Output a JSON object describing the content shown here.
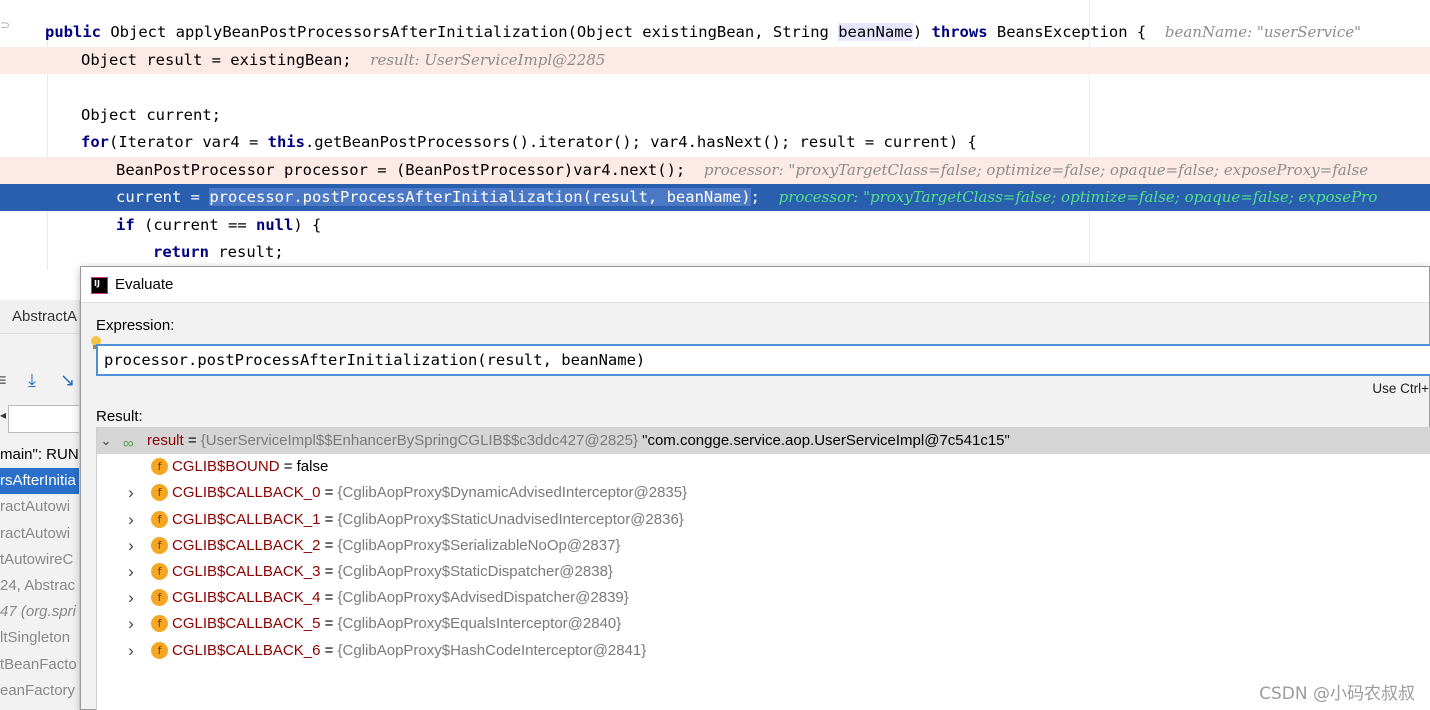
{
  "editor": {
    "lines": {
      "l1_kw_public": "public",
      "l1_a": " Object applyBeanPostProcessorsAfterInitialization(Object existingBean, String ",
      "l1_beanName": "beanName",
      "l1_b": ") ",
      "l1_kw_throws": "throws",
      "l1_c": " BeansException {",
      "l1_hint": "beanName: \"userService\"",
      "l2": "Object result = existingBean;",
      "l2_hint": "result: UserServiceImpl@2285",
      "l4": "Object current;",
      "l5_kw_for": "for",
      "l5_a": "(Iterator var4 = ",
      "l5_kw_this": "this",
      "l5_b": ".getBeanPostProcessors().iterator(); var4.hasNext(); result = current) {",
      "l6": "BeanPostProcessor processor = (BeanPostProcessor)var4.next();",
      "l6_hint": "processor: \"proxyTargetClass=false; optimize=false; opaque=false; exposeProxy=false",
      "l7_a": "current = ",
      "l7_sel": "processor.postProcessAfterInitialization(result, beanName)",
      "l7_b": ";",
      "l7_hint": "processor: \"proxyTargetClass=false; optimize=false; opaque=false; exposePro",
      "l8_kw_if": "if",
      "l8_a": " (current == ",
      "l8_kw_null": "null",
      "l8_b": ") {",
      "l9_kw_return": "return",
      "l9_a": " result;"
    }
  },
  "left_panel": {
    "tab": "AbstractA",
    "frames": [
      {
        "text": "main\": RUN",
        "style": "thread"
      },
      {
        "text": "rsAfterInitia",
        "style": "sel"
      },
      {
        "text": "ractAutowi",
        "style": "normal"
      },
      {
        "text": "ractAutowi",
        "style": "normal"
      },
      {
        "text": "tAutowireC",
        "style": "normal"
      },
      {
        "text": "24, Abstrac",
        "style": "normal"
      },
      {
        "text": "47 (org.spri",
        "style": "it"
      },
      {
        "text": "ltSingleton",
        "style": "normal"
      },
      {
        "text": "tBeanFacto",
        "style": "normal"
      },
      {
        "text": "eanFactory",
        "style": "normal"
      }
    ]
  },
  "dialog": {
    "title": "Evaluate",
    "expression_label": "Expression:",
    "expression_value": "processor.postProcessAfterInitialization(result, beanName)",
    "ctrl_hint": "Use Ctrl+",
    "result_label": "Result:",
    "result": {
      "name": "result",
      "eq": " = ",
      "type": "{UserServiceImpl$$EnhancerBySpringCGLIB$$c3ddc427@2825}",
      "value": " \"com.congge.service.aop.UserServiceImpl@7c541c15\""
    },
    "fields": [
      {
        "name": "CGLIB$BOUND",
        "type": "",
        "value": "false",
        "expandable": false
      },
      {
        "name": "CGLIB$CALLBACK_0",
        "type": "{CglibAopProxy$DynamicAdvisedInterceptor@2835}",
        "value": "",
        "expandable": true
      },
      {
        "name": "CGLIB$CALLBACK_1",
        "type": "{CglibAopProxy$StaticUnadvisedInterceptor@2836}",
        "value": "",
        "expandable": true
      },
      {
        "name": "CGLIB$CALLBACK_2",
        "type": "{CglibAopProxy$SerializableNoOp@2837}",
        "value": "",
        "expandable": true
      },
      {
        "name": "CGLIB$CALLBACK_3",
        "type": "{CglibAopProxy$StaticDispatcher@2838}",
        "value": "",
        "expandable": true
      },
      {
        "name": "CGLIB$CALLBACK_4",
        "type": "{CglibAopProxy$AdvisedDispatcher@2839}",
        "value": "",
        "expandable": true
      },
      {
        "name": "CGLIB$CALLBACK_5",
        "type": "{CglibAopProxy$EqualsInterceptor@2840}",
        "value": "",
        "expandable": true
      },
      {
        "name": "CGLIB$CALLBACK_6",
        "type": "{CglibAopProxy$HashCodeInterceptor@2841}",
        "value": "",
        "expandable": true
      }
    ],
    "field_icon_letter": "f"
  },
  "watermark": "CSDN @小码农叔叔",
  "colors": {
    "selection": "#2a5fb0",
    "keyword": "#000080",
    "field_name": "#8b0000",
    "error_line": "#fbeae6"
  }
}
